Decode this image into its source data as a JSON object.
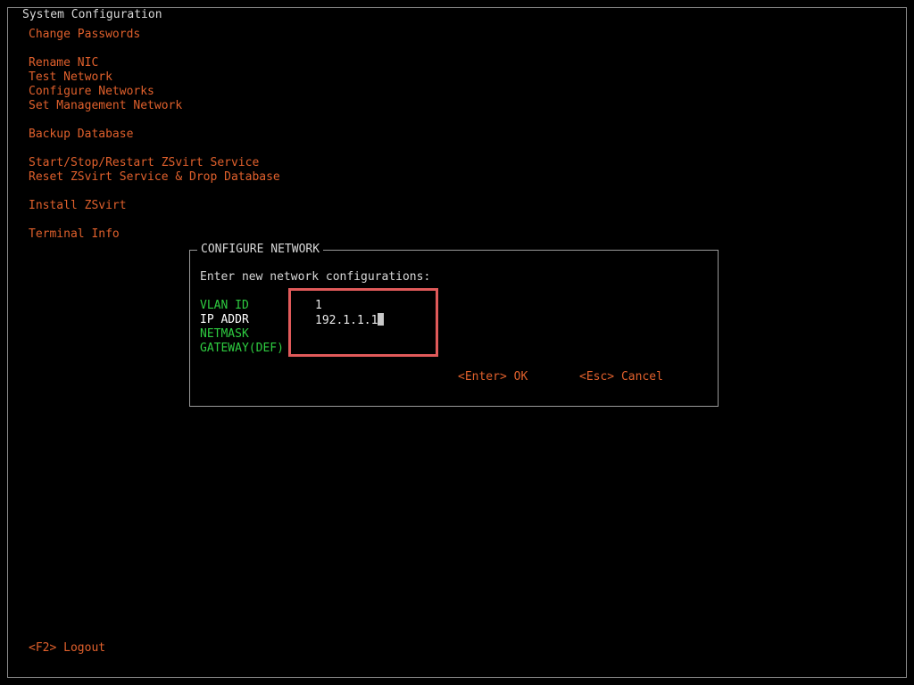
{
  "window": {
    "title": "System Configuration"
  },
  "menu": {
    "items": [
      {
        "label": "Change Passwords"
      },
      {
        "label": "Rename NIC"
      },
      {
        "label": "Test Network"
      },
      {
        "label": "Configure Networks"
      },
      {
        "label": "Set Management Network"
      },
      {
        "label": "Backup Database"
      },
      {
        "label": "Start/Stop/Restart ZSvirt Service"
      },
      {
        "label": "Reset ZSvirt Service & Drop Database"
      },
      {
        "label": "Install ZSvirt"
      },
      {
        "label": "Terminal Info"
      }
    ]
  },
  "dialog": {
    "title": "CONFIGURE NETWORK",
    "prompt": "Enter new network configurations:",
    "fields": [
      {
        "label": "VLAN ID",
        "value": "1"
      },
      {
        "label": "IP ADDR",
        "value": "192.1.1.1"
      },
      {
        "label": "NETMASK",
        "value": ""
      },
      {
        "label": "GATEWAY(DEF)",
        "value": ""
      }
    ],
    "ok_label": "<Enter> OK",
    "cancel_label": "<Esc> Cancel"
  },
  "footer": {
    "logout_label": "<F2> Logout"
  },
  "colors": {
    "menu_text": "#e0602c",
    "field_label": "#2ecc40",
    "active_field_label": "#ffffff",
    "highlight_border": "#e05a5a",
    "background": "#000000"
  }
}
